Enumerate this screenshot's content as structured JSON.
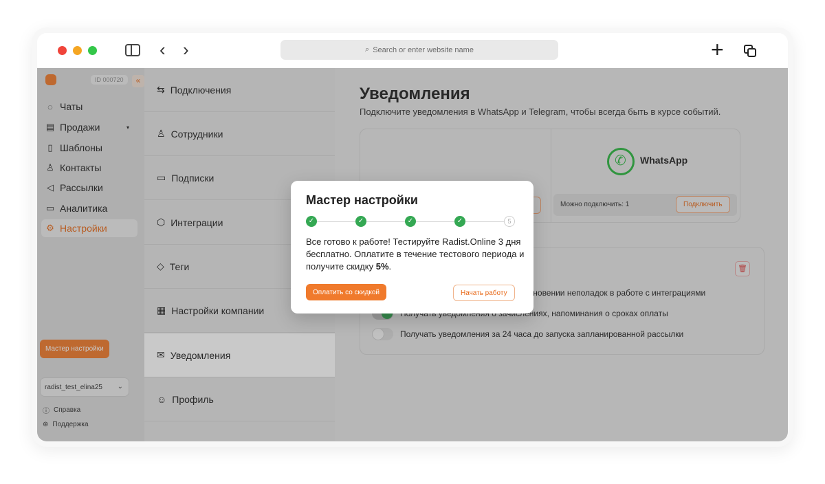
{
  "browser": {
    "url_placeholder": "Search or enter website name",
    "traffic_lights": {
      "close": "#f0443a",
      "minimize": "#f5a623",
      "zoom": "#34c749"
    }
  },
  "sidebar": {
    "account_id": "ID 000720",
    "items": [
      {
        "label": "Чаты",
        "icon": "chat-icon"
      },
      {
        "label": "Продажи",
        "icon": "sales-icon",
        "has_dropdown": true
      },
      {
        "label": "Шаблоны",
        "icon": "template-icon"
      },
      {
        "label": "Контакты",
        "icon": "contacts-icon"
      },
      {
        "label": "Рассылки",
        "icon": "megaphone-icon"
      },
      {
        "label": "Аналитика",
        "icon": "analytics-icon"
      },
      {
        "label": "Настройки",
        "icon": "settings-icon",
        "active": true
      }
    ],
    "wizard_button": "Мастер настройки",
    "user": "radist_test_elina25",
    "footer": {
      "help": "Справка",
      "support": "Поддержка"
    }
  },
  "settings_menu": {
    "items": [
      {
        "label": "Подключения",
        "icon": "connections-icon"
      },
      {
        "label": "Сотрудники",
        "icon": "employees-icon"
      },
      {
        "label": "Подписки",
        "icon": "subscriptions-icon"
      },
      {
        "label": "Интеграции",
        "icon": "integrations-icon"
      },
      {
        "label": "Теги",
        "icon": "tag-icon"
      },
      {
        "label": "Настройки компании",
        "icon": "company-icon"
      },
      {
        "label": "Уведомления",
        "icon": "notifications-icon",
        "selected": true
      },
      {
        "label": "Профиль",
        "icon": "profile-icon"
      }
    ]
  },
  "main": {
    "title": "Уведомления",
    "subtitle": "Подключите уведомления в WhatsApp и Telegram, чтобы всегда быть в курсе событий.",
    "whatsapp": {
      "name": "WhatsApp",
      "available": "Можно подключить: 1",
      "connect_button": "Подключить"
    },
    "toggles": [
      {
        "label": "Получать уведомления при возникновении неполадок в работе с интеграциями",
        "on": true
      },
      {
        "label": "Получать уведомления о зачислениях, напоминания о сроках оплаты",
        "on": true
      },
      {
        "label": "Получать уведомления за 24 часа до запуска запланированной рассылки",
        "on": false
      }
    ]
  },
  "modal": {
    "title": "Мастер настройки",
    "steps": [
      {
        "done": true
      },
      {
        "done": true
      },
      {
        "done": true
      },
      {
        "done": true
      },
      {
        "done": false,
        "label": "5"
      }
    ],
    "text_main": "Все готово к работе! Тестируйте Radist.Online 3 дня бесплатно. Оплатите в течение тестового периода и получите скидку ",
    "text_bold": "5%",
    "text_end": ".",
    "pay_button": "Оплатить со скидкой",
    "start_button": "Начать работу"
  },
  "colors": {
    "accent": "#f07a2c",
    "success": "#34a853"
  }
}
